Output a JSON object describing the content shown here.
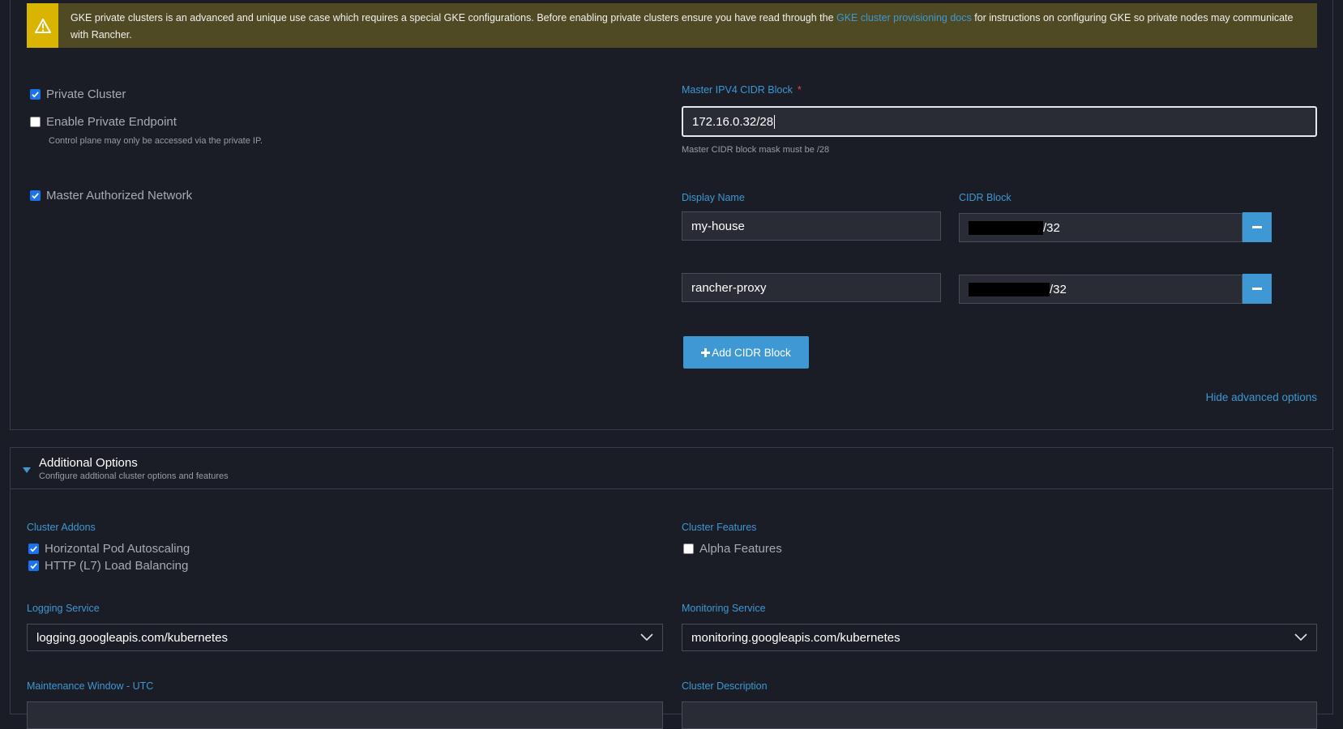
{
  "banner": {
    "text_before": "GKE private clusters is an advanced and unique use case which requires a special GKE configurations. Before enabling private clusters ensure you have read through the ",
    "link": "GKE cluster provisioning docs",
    "text_after": " for instructions on configuring GKE so private nodes may communicate with Rancher."
  },
  "private_cluster": {
    "label": "Private Cluster",
    "checked": true
  },
  "private_endpoint": {
    "label": "Enable Private Endpoint",
    "checked": false,
    "help": "Control plane may only be accessed via the private IP."
  },
  "master_authorized_network": {
    "label": "Master Authorized Network",
    "checked": true
  },
  "master_cidr": {
    "label": "Master IPV4 CIDR Block",
    "required_mark": "*",
    "value": "172.16.0.32/28",
    "help": "Master CIDR block mask must be /28"
  },
  "networks": {
    "display_name_label": "Display Name",
    "cidr_label": "CIDR Block",
    "rows": [
      {
        "name": "my-house",
        "cidr_suffix": "/32"
      },
      {
        "name": "rancher-proxy",
        "cidr_suffix": "/32"
      }
    ],
    "add_button": "Add CIDR Block"
  },
  "hide_advanced": "Hide advanced options",
  "additional_options": {
    "title": "Additional Options",
    "subtitle": "Configure addtional cluster options and features"
  },
  "cluster_addons": {
    "label": "Cluster Addons",
    "items": [
      {
        "label": "Horizontal Pod Autoscaling",
        "checked": true
      },
      {
        "label": "HTTP (L7) Load Balancing",
        "checked": true
      }
    ]
  },
  "cluster_features": {
    "label": "Cluster Features",
    "items": [
      {
        "label": "Alpha Features",
        "checked": false
      }
    ]
  },
  "logging_service": {
    "label": "Logging Service",
    "value": "logging.googleapis.com/kubernetes"
  },
  "monitoring_service": {
    "label": "Monitoring Service",
    "value": "monitoring.googleapis.com/kubernetes"
  },
  "maintenance_window": {
    "label": "Maintenance Window - UTC"
  },
  "cluster_description": {
    "label": "Cluster Description"
  },
  "colors": {
    "accent": "#3d98d3",
    "warning": "#d9b400",
    "background": "#1b1d26"
  }
}
